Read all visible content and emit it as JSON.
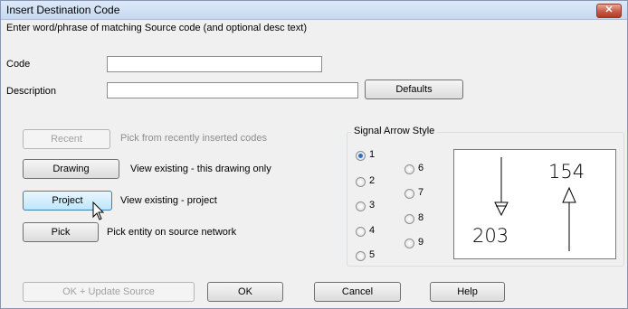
{
  "window": {
    "title": "Insert Destination Code",
    "close_glyph": "✕"
  },
  "instruction": "Enter word/phrase of matching Source code (and optional desc text)",
  "code": {
    "label": "Code",
    "value": ""
  },
  "description": {
    "label": "Description",
    "value": ""
  },
  "defaults_button": "Defaults",
  "actions": [
    {
      "button": "Recent",
      "text": "Pick from recently inserted codes",
      "enabled": false
    },
    {
      "button": "Drawing",
      "text": "View existing - this drawing only",
      "enabled": true
    },
    {
      "button": "Project",
      "text": "View existing - project",
      "enabled": true
    },
    {
      "button": "Pick",
      "text": "Pick entity on source network",
      "enabled": true
    }
  ],
  "signal_arrow_style": {
    "label": "Signal Arrow Style",
    "options": [
      "1",
      "2",
      "3",
      "4",
      "5",
      "6",
      "7",
      "8",
      "9"
    ],
    "selected": "1",
    "preview": {
      "top_right_number": "154",
      "bottom_left_number": "203"
    }
  },
  "footer": {
    "ok_update": "OK + Update Source",
    "ok": "OK",
    "cancel": "Cancel",
    "help": "Help"
  },
  "icons": {
    "cursor": "mouse-pointer-icon"
  }
}
